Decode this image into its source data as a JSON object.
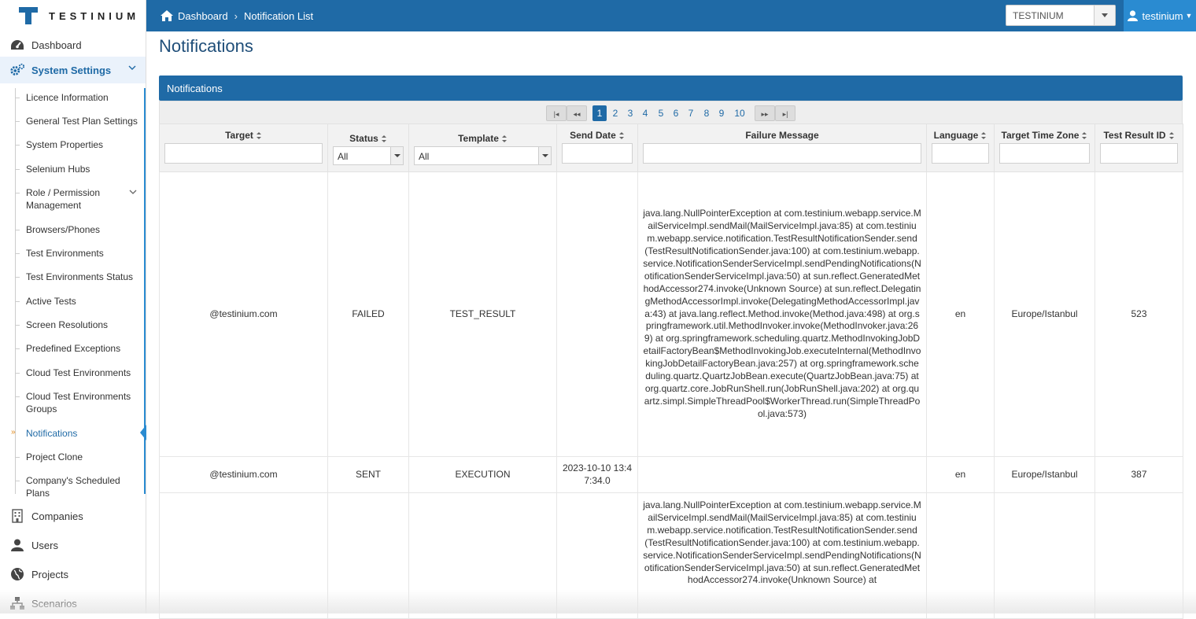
{
  "app": {
    "logo_text": "TESTINIUM"
  },
  "breadcrumb": {
    "home": "Dashboard",
    "current": "Notification List"
  },
  "org_selector": {
    "value": "TESTINIUM"
  },
  "user_menu": {
    "label": "testinium"
  },
  "sidebar": {
    "dashboard": "Dashboard",
    "system_settings": "System Settings",
    "submenu": [
      "Licence Information",
      "General Test Plan Settings",
      "System Properties",
      "Selenium Hubs",
      "Role / Permission Management",
      "Browsers/Phones",
      "Test Environments",
      "Test Environments Status",
      "Active Tests",
      "Screen Resolutions",
      "Predefined Exceptions",
      "Cloud Test Environments",
      "Cloud Test Environments Groups",
      "Notifications",
      "Project Clone",
      "Company's Scheduled Plans"
    ],
    "bottom": [
      "Companies",
      "Users",
      "Projects",
      "Scenarios"
    ]
  },
  "page": {
    "title": "Notifications",
    "panel_title": "Notifications"
  },
  "pager": {
    "pages": [
      "1",
      "2",
      "3",
      "4",
      "5",
      "6",
      "7",
      "8",
      "9",
      "10"
    ],
    "current": "1",
    "first": "|◂",
    "prev": "◂◂",
    "next": "▸▸",
    "last": "▸|"
  },
  "table": {
    "headers": [
      "Target",
      "Status",
      "Template",
      "Send Date",
      "Failure Message",
      "Language",
      "Target Time Zone",
      "Test Result ID"
    ],
    "filters": {
      "status": "All",
      "template": "All"
    },
    "rows": [
      {
        "target": "@testinium.com",
        "status": "FAILED",
        "template": "TEST_RESULT",
        "send_date": "",
        "failure": "java.lang.NullPointerException at com.testinium.webapp.service.MailServiceImpl.sendMail(MailServiceImpl.java:85) at com.testinium.webapp.service.notification.TestResultNotificationSender.send(TestResultNotificationSender.java:100) at com.testinium.webapp.service.NotificationSenderServiceImpl.sendPendingNotifications(NotificationSenderServiceImpl.java:50) at sun.reflect.GeneratedMethodAccessor274.invoke(Unknown Source) at sun.reflect.DelegatingMethodAccessorImpl.invoke(DelegatingMethodAccessorImpl.java:43) at java.lang.reflect.Method.invoke(Method.java:498) at org.springframework.util.MethodInvoker.invoke(MethodInvoker.java:269) at org.springframework.scheduling.quartz.MethodInvokingJobDetailFactoryBean$MethodInvokingJob.executeInternal(MethodInvokingJobDetailFactoryBean.java:257) at org.springframework.scheduling.quartz.QuartzJobBean.execute(QuartzJobBean.java:75) at org.quartz.core.JobRunShell.run(JobRunShell.java:202) at org.quartz.simpl.SimpleThreadPool$WorkerThread.run(SimpleThreadPool.java:573)",
        "language": "en",
        "timezone": "Europe/Istanbul",
        "result_id": "523"
      },
      {
        "target": "@testinium.com",
        "status": "SENT",
        "template": "EXECUTION",
        "send_date": "2023-10-10 13:47:34.0",
        "failure": "",
        "language": "en",
        "timezone": "Europe/Istanbul",
        "result_id": "387"
      },
      {
        "target": "",
        "status": "",
        "template": "",
        "send_date": "",
        "failure": "java.lang.NullPointerException at com.testinium.webapp.service.MailServiceImpl.sendMail(MailServiceImpl.java:85) at com.testinium.webapp.service.notification.TestResultNotificationSender.send(TestResultNotificationSender.java:100) at com.testinium.webapp.service.NotificationSenderServiceImpl.sendPendingNotifications(NotificationSenderServiceImpl.java:50) at sun.reflect.GeneratedMethodAccessor274.invoke(Unknown Source) at",
        "language": "",
        "timezone": "",
        "result_id": ""
      }
    ]
  },
  "colors": {
    "brand_blue": "#1f6aa6",
    "accent_blue": "#2a8bd1",
    "current_marker": "#e08a1c"
  }
}
